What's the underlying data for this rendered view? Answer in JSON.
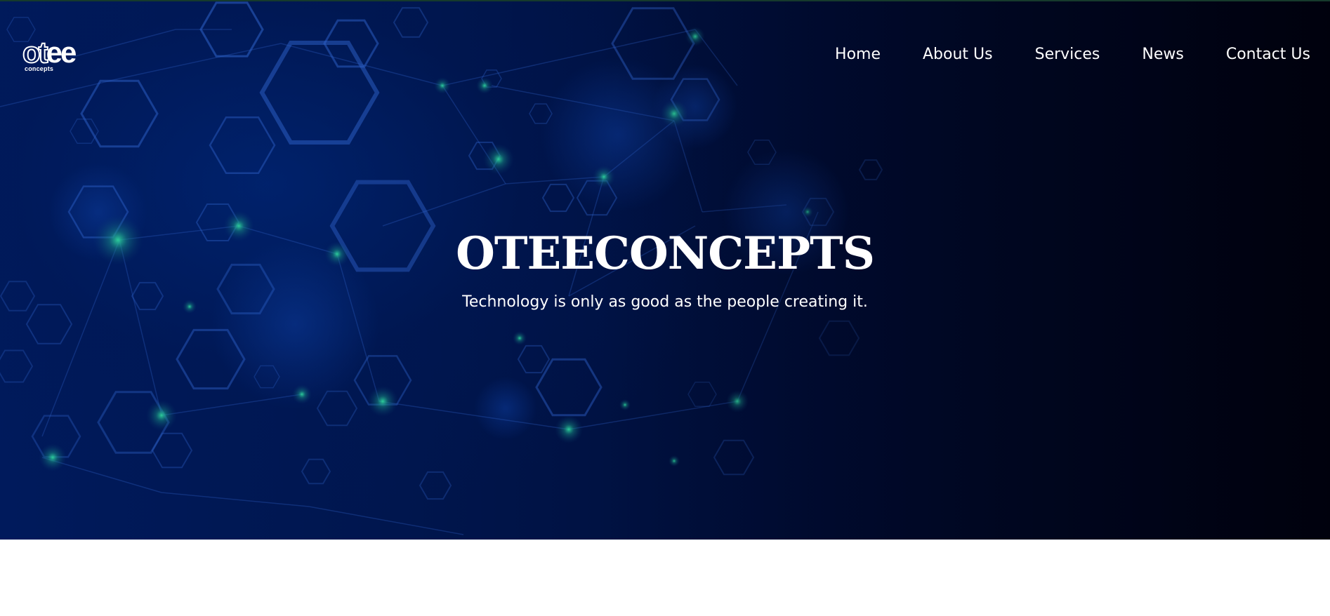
{
  "brand": {
    "logo_text_outline": "ot",
    "logo_text_solid": "ee",
    "logo_subtext": "concepts"
  },
  "nav": {
    "items": [
      {
        "label": "Home"
      },
      {
        "label": "About Us"
      },
      {
        "label": "Services"
      },
      {
        "label": "News"
      },
      {
        "label": "Contact Us"
      }
    ]
  },
  "hero": {
    "title": "OTEECONCEPTS",
    "tagline": "Technology is only as good as the people creating it.",
    "background_colors": [
      "#001a5c",
      "#000c34",
      "#00041a"
    ],
    "accent_glow": "#1fb58a"
  }
}
